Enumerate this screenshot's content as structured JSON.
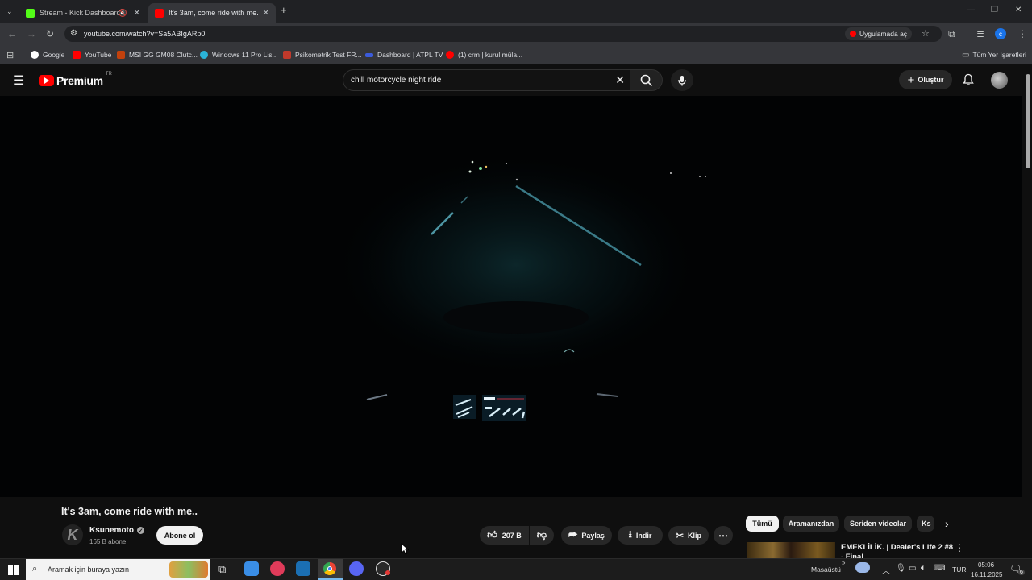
{
  "browser": {
    "tabs": [
      {
        "title": "Stream - Kick Dashboard",
        "active": false
      },
      {
        "title": "It's 3am, come ride with me.. -",
        "active": true
      }
    ],
    "url": "youtube.com/watch?v=Sa5ABIgARp0",
    "open_in_app": "Uygulamada aç",
    "profile_letter": "c",
    "bookmarks": [
      "Google",
      "YouTube",
      "MSI GG GM08 Clutc...",
      "Windows 11 Pro Lis...",
      "Psikometrik Test FR...",
      "Dashboard | ATPL TV",
      "(1) crm | kurul müla..."
    ],
    "all_bookmarks": "Tüm Yer İşaretleri"
  },
  "youtube": {
    "logo_text": "Premium",
    "logo_sup": "TR",
    "search_value": "chill motorcycle night ride",
    "create_label": "Oluştur"
  },
  "video": {
    "title": "It's 3am, come ride with me..",
    "channel": "Ksunemoto",
    "channel_initial": "K",
    "subscribers": "165 B abone",
    "subscribe_label": "Abone ol",
    "likes": "207 B",
    "share_label": "Paylaş",
    "download_label": "İndir",
    "clip_label": "Klip"
  },
  "recommendations": {
    "chips": [
      "Tümü",
      "Aramanızdan",
      "Seriden videolar",
      "Ks"
    ],
    "first_title": "EMEKLİLİK. | Dealer's Life 2 #8 - Final"
  },
  "taskbar": {
    "search_placeholder": "Aramak için buraya yazın",
    "desktop_label": "Masaüstü",
    "language": "TUR",
    "time": "05:06",
    "date": "16.11.2025",
    "notifications": "6"
  },
  "colors": {
    "youtube_red": "#ff0000",
    "kick_green": "#53fc18",
    "chrome_dark": "#202124",
    "yt_bg": "#0f0f0f"
  }
}
